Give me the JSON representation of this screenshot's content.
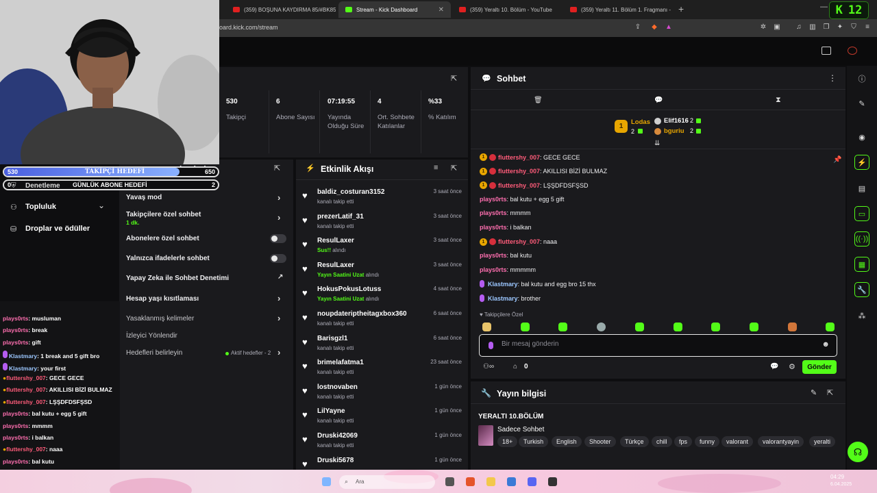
{
  "browser": {
    "tabs": [
      {
        "label": "(359) BOŞUNA KAYDIRMA 85/#BK85"
      },
      {
        "label": "Stream - Kick Dashboard"
      },
      {
        "label": "(359) Yeraltı 10. Bölüm - YouTube"
      },
      {
        "label": "(359) Yeraltı 11. Bölüm 1. Fragmanı -"
      }
    ],
    "url": "oard.kick.com/stream",
    "badge_k": "K",
    "badge_num": "12"
  },
  "stats": {
    "items": [
      {
        "value": "530",
        "label": "Takipçi"
      },
      {
        "value": "6",
        "label": "Abone Sayısı"
      },
      {
        "value": "07:19:55",
        "label": "Yayında Olduğu Süre"
      },
      {
        "value": "4",
        "label": "Ort. Sohbete Katılanlar"
      },
      {
        "value": "%33",
        "label": "% Katılım"
      }
    ]
  },
  "goals": {
    "follower_left": "530",
    "follower_label": "TAKİPÇİ HEDEFİ",
    "follower_right": "650",
    "sub_left": "0",
    "sub_label": "GÜNLÜK ABONE HEDEFİ",
    "sub_right": "2",
    "behind_text": "demleri"
  },
  "left_nav": {
    "moderation": "Denetleme",
    "community": "Topluluk",
    "drops": "Droplar ve ödüller"
  },
  "chat_settings": {
    "slow_mode": "Yavaş mod",
    "followers_only": "Takipçilere özel sohbet",
    "followers_only_value": "1 dk.",
    "subs_only": "Abonelere özel sohbet",
    "emotes_only": "Yalnızca ifadelerle sohbet",
    "ai_moderation": "Yapay Zeka ile Sohbet Denetimi",
    "age_restrictions": "Hesap yaşı kısıtlaması",
    "banned_words": "Yasaklanmış kelimeler",
    "viewer_redirect": "İzleyici Yönlendir",
    "set_goals": "Hedefleri belirleyin",
    "active_goals": "Aktif hedefler - 2"
  },
  "activity": {
    "title": "Etkinlik Akışı",
    "items": [
      {
        "name": "baldiz_costuran3152",
        "sub": "kanalı takip etti",
        "time": "3 saat önce"
      },
      {
        "name": "prezerLatif_31",
        "sub": "kanalı takip etti",
        "time": "3 saat önce"
      },
      {
        "name": "ResulLaxer",
        "sub_hl": "Sus!!",
        "sub": "alındı",
        "time": "3 saat önce"
      },
      {
        "name": "ResulLaxer",
        "sub_hl": "Yayın Saatini Uzat",
        "sub": "alındı",
        "time": "3 saat önce"
      },
      {
        "name": "HokusPokusLotuss",
        "sub_hl": "Yayın Saatini Uzat",
        "sub": "alındı",
        "time": "4 saat önce"
      },
      {
        "name": "noupdateriptheitagxbox360",
        "sub": "kanalı takip etti",
        "time": "6 saat önce"
      },
      {
        "name": "Barisgzl1",
        "sub": "kanalı takip etti",
        "time": "6 saat önce"
      },
      {
        "name": "brimelafatma1",
        "sub": "kanalı takip etti",
        "time": "23 saat önce"
      },
      {
        "name": "lostnovaben",
        "sub": "kanalı takip etti",
        "time": "1 gün önce"
      },
      {
        "name": "LilYayne",
        "sub": "kanalı takip etti",
        "time": "1 gün önce"
      },
      {
        "name": "Druski42069",
        "sub": "kanalı takip etti",
        "time": "1 gün önce"
      },
      {
        "name": "Druski5678",
        "sub": "",
        "time": "1 gün önce"
      }
    ]
  },
  "chat": {
    "title": "Sohbet",
    "leaderboard": {
      "first_name": "Lodas",
      "first_count": "2",
      "second_name": "Elif1616",
      "second_count": "2",
      "third_name": "bguriu",
      "third_count": "2",
      "rank": "1"
    },
    "messages": [
      {
        "user": "fluttershy_007",
        "text": ": GECE GECE",
        "badges": "mod"
      },
      {
        "user": "fluttershy_007",
        "text": ": AKILLISI BİZİ BULMAZ",
        "badges": "mod"
      },
      {
        "user": "fluttershy_007",
        "text": ": LŞŞDFDSFŞSD",
        "badges": "mod"
      },
      {
        "user": "plays0rts",
        "text": ": bal kutu + egg 5 gift",
        "badges": ""
      },
      {
        "user": "plays0rts",
        "text": ": mmmm",
        "badges": ""
      },
      {
        "user": "plays0rts",
        "text": ": i balkan",
        "badges": ""
      },
      {
        "user": "fluttershy_007",
        "text": ": naaa",
        "badges": "mod"
      },
      {
        "user": "plays0rts",
        "text": ": bal kutu",
        "badges": ""
      },
      {
        "user": "plays0rts",
        "text": ": mmmmm",
        "badges": ""
      },
      {
        "user": "Klastmary",
        "text": ": bal kutu and egg bro 15 thx",
        "badges": "mic"
      },
      {
        "user": "Klastmary",
        "text": ": brother",
        "badges": "mic"
      }
    ],
    "mode_label": "Takipçilere Özel",
    "input_placeholder": "Bir mesaj gönderin",
    "viewer_count": "0",
    "send_label": "Gönder"
  },
  "stream_info": {
    "title": "Yayın bilgisi",
    "stream_title": "YERALTI 10.BÖLÜM",
    "category": "Sadece Sohbet",
    "tags": [
      "18+",
      "Turkish",
      "English",
      "Shooter",
      "Türkçe",
      "chill",
      "fps",
      "funny",
      "valorant",
      "valorantyayin",
      "yeralti"
    ]
  },
  "overlay_chat": {
    "lines": [
      {
        "user": "plays0rts",
        "text": ": musluman",
        "badges": ""
      },
      {
        "user": "plays0rts",
        "text": ": break",
        "badges": ""
      },
      {
        "user": "plays0rts",
        "text": ": gift",
        "badges": ""
      },
      {
        "user": "Klastmary",
        "text": ": 1 break and 5 gift bro",
        "badges": "mic"
      },
      {
        "user": "Klastmary",
        "text": ": your first",
        "badges": "mic"
      },
      {
        "user": "fluttershy_007",
        "text": ": GECE GECE",
        "badges": "mod"
      },
      {
        "user": "fluttershy_007",
        "text": ": AKILLISI BİZİ BULMAZ",
        "badges": "mod"
      },
      {
        "user": "fluttershy_007",
        "text": ": LŞŞDFDSFŞSD",
        "badges": "mod"
      },
      {
        "user": "plays0rts",
        "text": ": bal kutu + egg 5 gift",
        "badges": ""
      },
      {
        "user": "plays0rts",
        "text": ": mmmm",
        "badges": ""
      },
      {
        "user": "plays0rts",
        "text": ": i balkan",
        "badges": ""
      },
      {
        "user": "fluttershy_007",
        "text": ": naaa",
        "badges": "mod"
      },
      {
        "user": "plays0rts",
        "text": ": bal kutu",
        "badges": ""
      },
      {
        "user": "plays0rts",
        "text": ": mmmmm",
        "badges": ""
      },
      {
        "user": "Klastmary",
        "text": ": bal kutu and egg bro 15 thx",
        "badges": "mic"
      }
    ]
  },
  "taskbar": {
    "search_placeholder": "Ara",
    "time": "04:29",
    "date": "6.04.2025"
  },
  "colors": {
    "accent": "#53fc18",
    "panel": "#1a1a1d",
    "background": "#0e0e10",
    "mod_name": "#ff5c7a",
    "user_name": "#ff6fb0"
  }
}
